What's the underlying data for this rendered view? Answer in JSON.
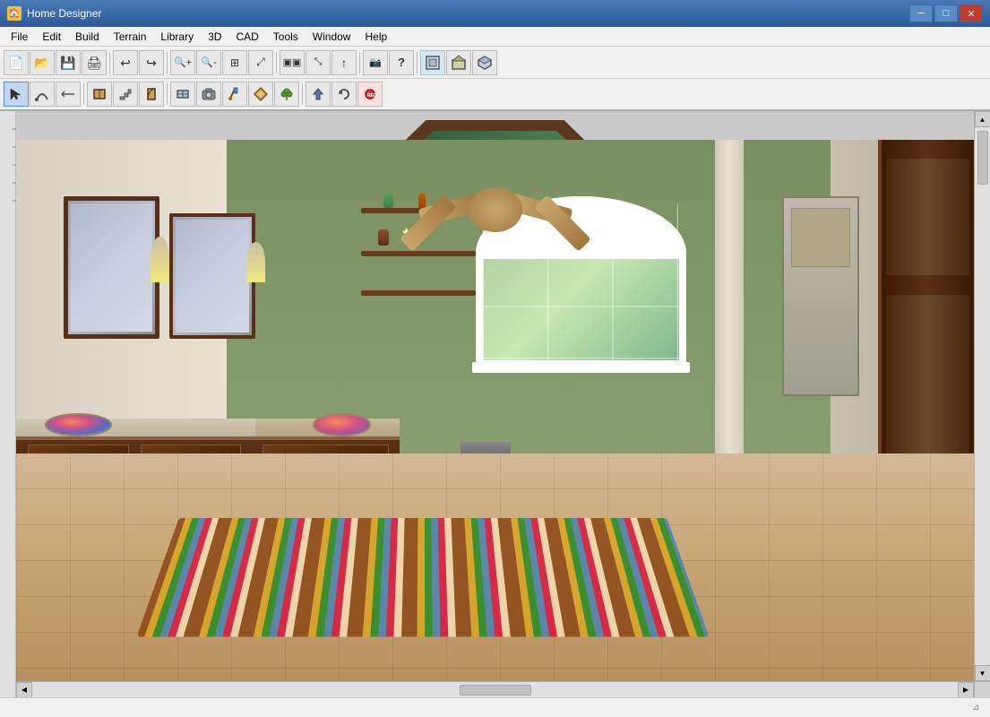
{
  "app": {
    "title": "Home Designer",
    "icon": "🏠"
  },
  "title_bar": {
    "title": "Home Designer",
    "minimize_label": "─",
    "maximize_label": "□",
    "close_label": "✕"
  },
  "menu_bar": {
    "items": [
      {
        "id": "file",
        "label": "File"
      },
      {
        "id": "edit",
        "label": "Edit"
      },
      {
        "id": "build",
        "label": "Build"
      },
      {
        "id": "terrain",
        "label": "Terrain"
      },
      {
        "id": "library",
        "label": "Library"
      },
      {
        "id": "3d",
        "label": "3D"
      },
      {
        "id": "cad",
        "label": "CAD"
      },
      {
        "id": "tools",
        "label": "Tools"
      },
      {
        "id": "window",
        "label": "Window"
      },
      {
        "id": "help",
        "label": "Help"
      }
    ]
  },
  "toolbar1": {
    "buttons": [
      {
        "id": "new",
        "icon": "📄",
        "label": "New"
      },
      {
        "id": "open",
        "icon": "📁",
        "label": "Open"
      },
      {
        "id": "save",
        "icon": "💾",
        "label": "Save"
      },
      {
        "id": "print",
        "icon": "🖨",
        "label": "Print"
      },
      {
        "id": "undo",
        "icon": "↩",
        "label": "Undo"
      },
      {
        "id": "redo",
        "icon": "↪",
        "label": "Redo"
      },
      {
        "id": "zoom-in",
        "icon": "🔍",
        "label": "Zoom In"
      },
      {
        "id": "zoom-out",
        "icon": "🔎",
        "label": "Zoom Out"
      },
      {
        "id": "zoom-fit",
        "icon": "⊞",
        "label": "Fit"
      },
      {
        "id": "fill-window",
        "icon": "⤢",
        "label": "Fill Window"
      },
      {
        "id": "select",
        "icon": "⊹",
        "label": "Select Objects"
      },
      {
        "id": "arrow",
        "icon": "↑",
        "label": "Arrow"
      },
      {
        "id": "camera",
        "icon": "📷",
        "label": "Camera"
      },
      {
        "id": "help-btn",
        "icon": "?",
        "label": "Help"
      },
      {
        "id": "floor-plan",
        "icon": "🏠",
        "label": "Floor Plan"
      },
      {
        "id": "elevation",
        "icon": "⬛",
        "label": "Elevation"
      },
      {
        "id": "3d-view",
        "icon": "◻",
        "label": "3D View"
      }
    ]
  },
  "toolbar2": {
    "buttons": [
      {
        "id": "select-tool",
        "icon": "↖",
        "label": "Select"
      },
      {
        "id": "arc-tool",
        "icon": "⌒",
        "label": "Arc"
      },
      {
        "id": "move-tool",
        "icon": "⇥",
        "label": "Move"
      },
      {
        "id": "cabinet-tool",
        "icon": "▦",
        "label": "Cabinet"
      },
      {
        "id": "stairs-tool",
        "icon": "▤",
        "label": "Stairs"
      },
      {
        "id": "door-tool",
        "icon": "▯",
        "label": "Door"
      },
      {
        "id": "window-tool",
        "icon": "⊞",
        "label": "Window"
      },
      {
        "id": "camera-tool",
        "icon": "📷",
        "label": "Camera"
      },
      {
        "id": "paint-tool",
        "icon": "🖌",
        "label": "Paint"
      },
      {
        "id": "material-tool",
        "icon": "⬡",
        "label": "Material"
      },
      {
        "id": "plant-tool",
        "icon": "🌿",
        "label": "Plant"
      },
      {
        "id": "arrow-up",
        "icon": "↑",
        "label": "Arrow Up"
      },
      {
        "id": "rotate-tool",
        "icon": "↻",
        "label": "Rotate"
      },
      {
        "id": "record",
        "icon": "⏺",
        "label": "Record"
      }
    ]
  },
  "viewport": {
    "scene_description": "3D interior bathroom view",
    "scroll_position": "center"
  },
  "status_bar": {
    "text": ""
  }
}
